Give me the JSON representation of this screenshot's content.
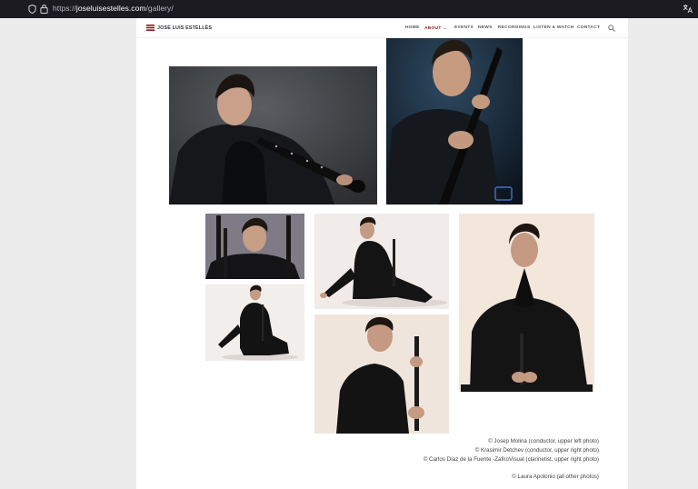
{
  "browser": {
    "url_scheme": "https://",
    "url_host": "joseluisestelles.com",
    "url_path": "/gallery/"
  },
  "header": {
    "brand": "JOSÉ LUIS ESTELLÉS",
    "nav": [
      {
        "label": "HOME"
      },
      {
        "label": "ABOUT"
      },
      {
        "label": "EVENTS"
      },
      {
        "label": "NEWS"
      },
      {
        "label": "RECORDINGS"
      },
      {
        "label": "LISTEN & WATCH"
      },
      {
        "label": "CONTACT"
      }
    ]
  },
  "credits": [
    "© Josep Molina (conductor, upper left photo)",
    "© Krasimir Detchev (conductor, upper right photo)",
    "© Carlos Díaz de la Fuente -ZafiroVisual (clarinetist, upper right photo)",
    "© Laura Apolonio (all other photos)"
  ],
  "colors": {
    "accent": "#8b1a1a",
    "chrome_bg": "#1c1b22",
    "page_bg": "#ececec"
  }
}
